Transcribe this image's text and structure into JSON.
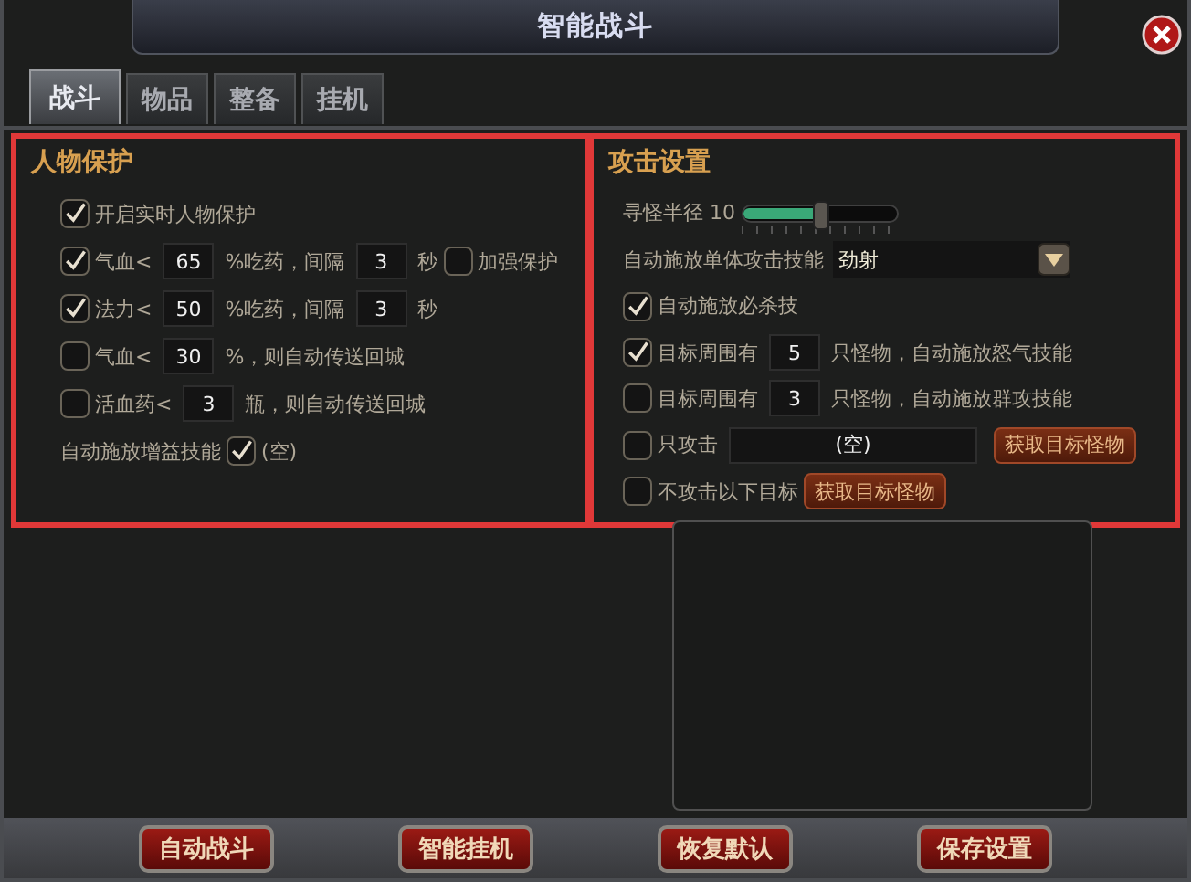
{
  "window": {
    "title": "智能战斗"
  },
  "tabs": [
    {
      "label": "战斗",
      "selected": true
    },
    {
      "label": "物品",
      "selected": false
    },
    {
      "label": "整备",
      "selected": false
    },
    {
      "label": "挂机",
      "selected": false
    }
  ],
  "sections": [
    {
      "title": "人物保护",
      "rows": [
        {
          "parts": [
            {
              "kind": "checkbox",
              "checked": true
            },
            {
              "kind": "text",
              "text": "开启实时人物保护"
            }
          ]
        },
        {
          "parts": [
            {
              "kind": "checkbox",
              "checked": true
            },
            {
              "kind": "text",
              "text": "气血<"
            },
            {
              "kind": "field",
              "value": "65"
            },
            {
              "kind": "text",
              "text": "%吃药，间隔"
            },
            {
              "kind": "field",
              "value": "3"
            },
            {
              "kind": "text",
              "text": "秒"
            },
            {
              "kind": "checkbox",
              "checked": false
            },
            {
              "kind": "text",
              "text": "加强保护"
            }
          ]
        },
        {
          "parts": [
            {
              "kind": "checkbox",
              "checked": true
            },
            {
              "kind": "text",
              "text": "法力<"
            },
            {
              "kind": "field",
              "value": "50"
            },
            {
              "kind": "text",
              "text": "%吃药，间隔"
            },
            {
              "kind": "field",
              "value": "3"
            },
            {
              "kind": "text",
              "text": "秒"
            }
          ]
        },
        {
          "parts": [
            {
              "kind": "checkbox",
              "checked": false
            },
            {
              "kind": "text",
              "text": "气血<"
            },
            {
              "kind": "field",
              "value": "30"
            },
            {
              "kind": "text",
              "text": "%，则自动传送回城"
            }
          ]
        },
        {
          "parts": [
            {
              "kind": "checkbox",
              "checked": false
            },
            {
              "kind": "text",
              "text": "活血药<"
            },
            {
              "kind": "field",
              "value": "3"
            },
            {
              "kind": "text",
              "text": "瓶，则自动传送回城"
            }
          ]
        },
        {
          "parts": [
            {
              "kind": "text",
              "text": "自动施放增益技能"
            },
            {
              "kind": "checkbox",
              "checked": true
            },
            {
              "kind": "text",
              "text": "(空)"
            }
          ]
        }
      ]
    },
    {
      "title": "攻击设置",
      "rows": [
        {
          "parts": [
            {
              "kind": "text",
              "text": "寻怪半径 10"
            },
            {
              "kind": "slider",
              "level": 0.5
            }
          ]
        },
        {
          "parts": [
            {
              "kind": "text",
              "text": "自动施放单体攻击技能"
            },
            {
              "kind": "dropdown",
              "value": "劲射"
            }
          ]
        },
        {
          "parts": [
            {
              "kind": "checkbox",
              "checked": true
            },
            {
              "kind": "text",
              "text": "自动施放必杀技"
            }
          ]
        },
        {
          "parts": [
            {
              "kind": "checkbox",
              "checked": true
            },
            {
              "kind": "text",
              "text": "目标周围有"
            },
            {
              "kind": "field",
              "value": "5"
            },
            {
              "kind": "text",
              "text": "只怪物，自动施放怒气技能"
            }
          ]
        },
        {
          "parts": [
            {
              "kind": "checkbox",
              "checked": false
            },
            {
              "kind": "text",
              "text": "目标周围有"
            },
            {
              "kind": "field",
              "value": "3"
            },
            {
              "kind": "text",
              "text": "只怪物，自动施放群攻技能"
            }
          ]
        },
        {
          "parts": [
            {
              "kind": "checkbox",
              "checked": false
            },
            {
              "kind": "text",
              "text": "只攻击"
            },
            {
              "kind": "widefield",
              "value": "(空)"
            },
            {
              "kind": "button",
              "label": "获取目标怪物"
            }
          ]
        },
        {
          "parts": [
            {
              "kind": "checkbox",
              "checked": false
            },
            {
              "kind": "text",
              "text": "不攻击以下目标"
            },
            {
              "kind": "button",
              "label": "获取目标怪物"
            }
          ]
        }
      ]
    }
  ],
  "buttons": [
    "自动战斗",
    "智能挂机",
    "恢复默认",
    "保存设置"
  ]
}
